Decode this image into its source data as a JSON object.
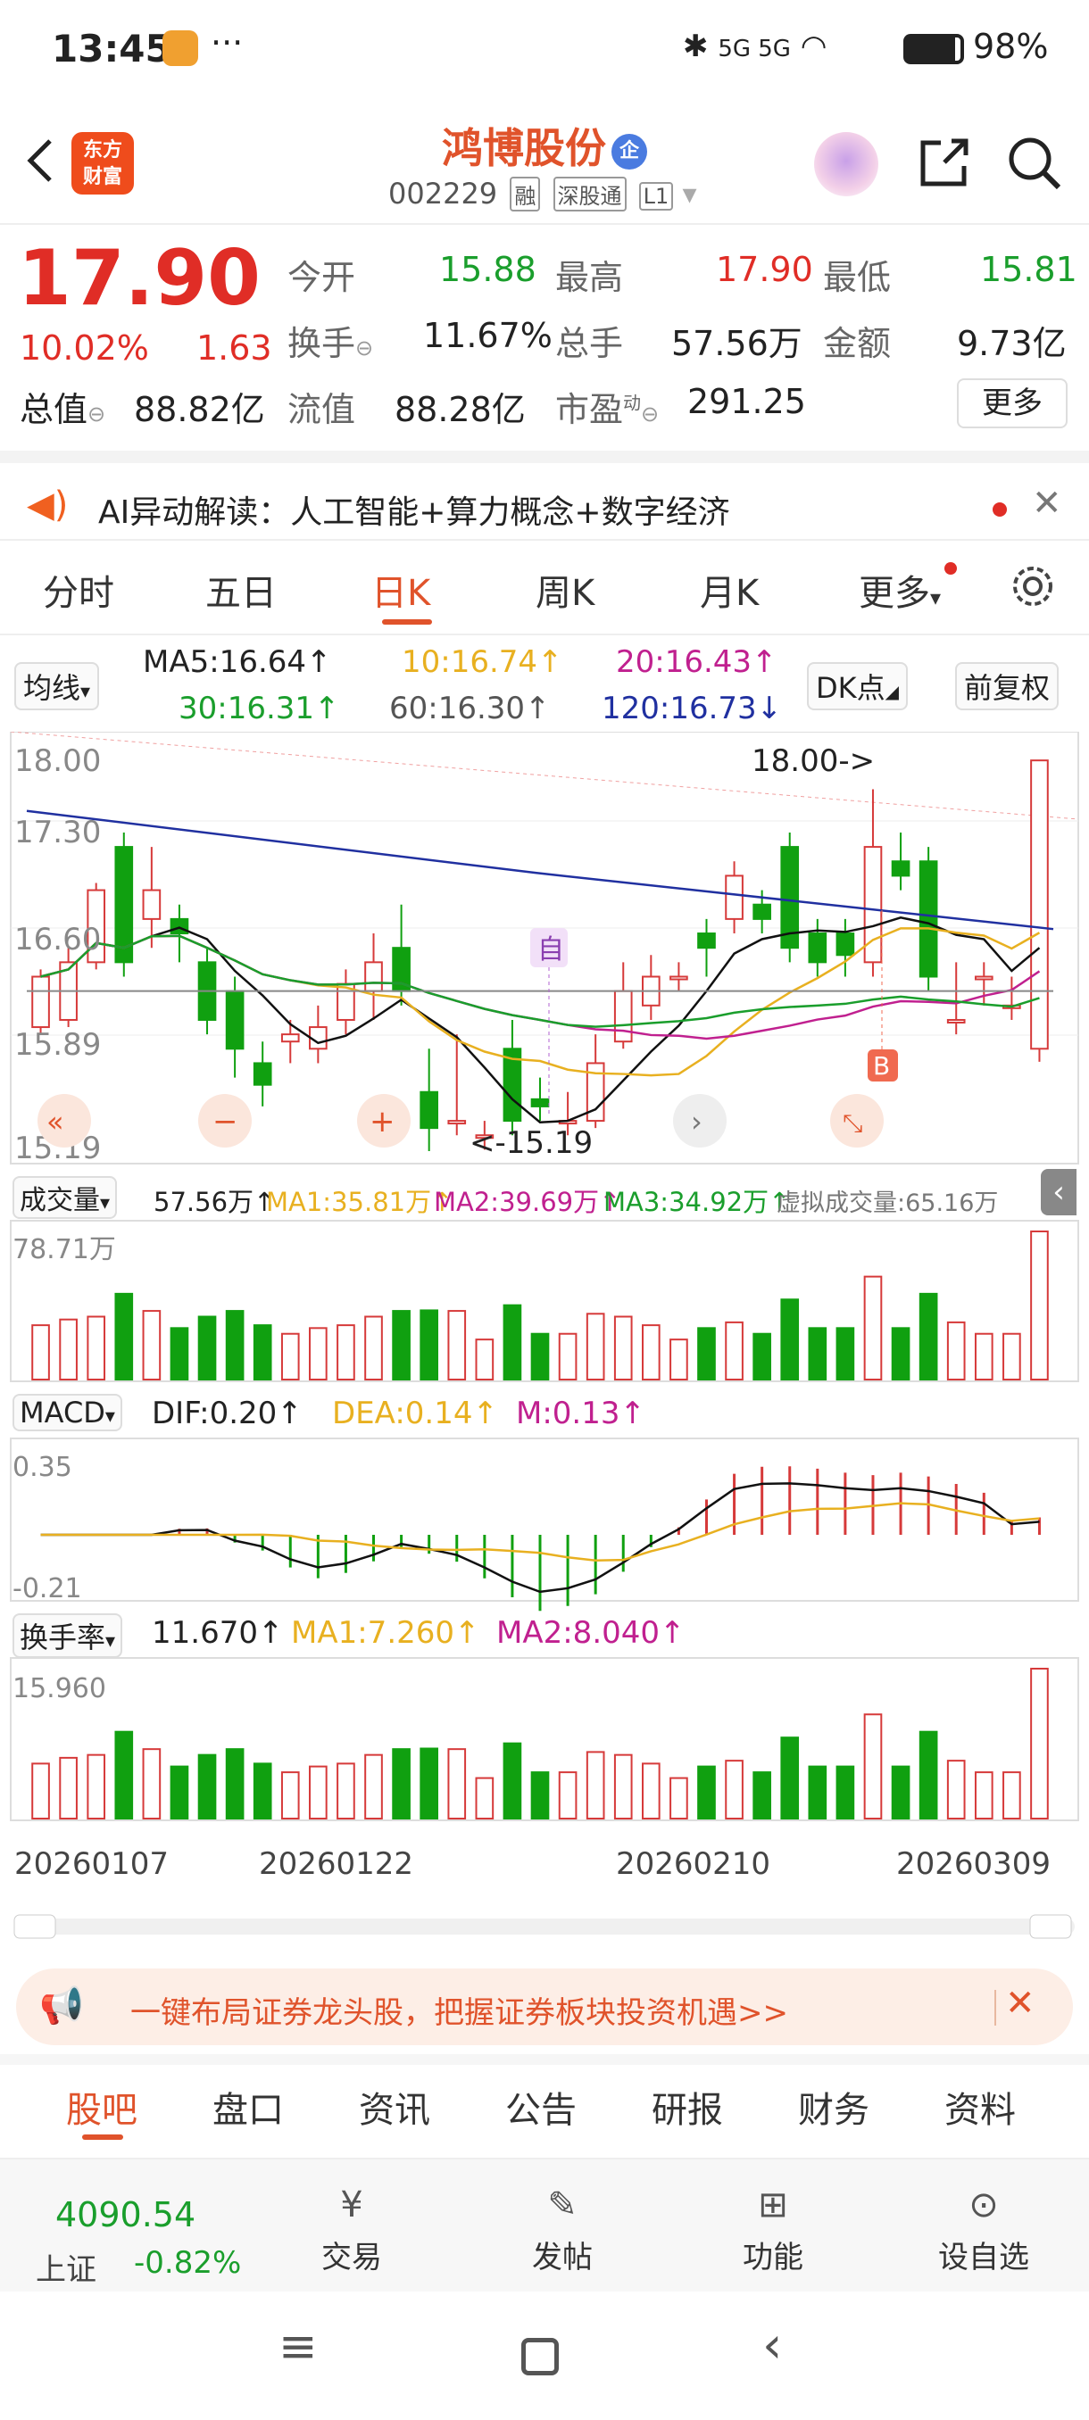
{
  "status": {
    "time": "13:45",
    "battery": "98%",
    "signal": "5G 5G"
  },
  "header": {
    "logo_text_1": "东方",
    "logo_text_2": "财富",
    "name": "鸿博股份",
    "badge": "企",
    "code": "002229",
    "tags": [
      "融",
      "深股通",
      "L1"
    ]
  },
  "quote": {
    "price": "17.90",
    "pct": "10.02%",
    "chg": "1.63",
    "open_label": "今开",
    "open": "15.88",
    "high_label": "最高",
    "high": "17.90",
    "low_label": "最低",
    "low": "15.81",
    "turnover_label": "换手",
    "turnover": "11.67%",
    "vol_label": "总手",
    "vol": "57.56万",
    "amt_label": "金额",
    "amt": "9.73亿",
    "mcap_label": "总值",
    "mcap": "88.82亿",
    "float_label": "流值",
    "float": "88.28亿",
    "pe_label": "市盈",
    "pe": "291.25",
    "pe_sup": "动",
    "more": "更多"
  },
  "ai": {
    "text": "AI异动解读：人工智能+算力概念+数字经济"
  },
  "ktabs": [
    "分时",
    "五日",
    "日K",
    "周K",
    "月K",
    "更多"
  ],
  "ma": {
    "sel": "均线",
    "ma5": "MA5:16.64↑",
    "ma10": "10:16.74↑",
    "ma20": "20:16.43↑",
    "ma30": "30:16.31↑",
    "ma60": "60:16.30↑",
    "ma120": "120:16.73↓",
    "dk": "DK点",
    "fq": "前复权"
  },
  "kline": {
    "y_labels": [
      "18.00",
      "17.30",
      "16.60",
      "15.89",
      "15.19"
    ],
    "max_label": "18.00->",
    "min_label": "<-15.19",
    "mark_zi": "自",
    "mark_b": "B"
  },
  "volume": {
    "sel": "成交量",
    "val": "57.56万↑",
    "ma1": "MA1:35.81万↑",
    "ma2": "MA2:39.69万↑",
    "ma3": "MA3:34.92万↑",
    "virtual": "虚拟成交量:65.16万",
    "ymax": "78.71万"
  },
  "macd": {
    "sel": "MACD",
    "dif": "DIF:0.20↑",
    "dea": "DEA:0.14↑",
    "m": "M:0.13↑",
    "ymax": "0.35",
    "ymin": "-0.21"
  },
  "hs": {
    "sel": "换手率",
    "val": "11.670↑",
    "ma1": "MA1:7.260↑",
    "ma2": "MA2:8.040↑",
    "ymax": "15.960"
  },
  "dates": [
    "20260107",
    "20260122",
    "20260210",
    "20260309"
  ],
  "banner": {
    "text": "一键布局证券龙头股，把握证券板块投资机遇>>"
  },
  "btabs": [
    "股吧",
    "盘口",
    "资讯",
    "公告",
    "研报",
    "财务",
    "资料"
  ],
  "bottom": {
    "index_val": "4090.54",
    "index_name": "上证",
    "index_pct": "-0.82%",
    "nav": [
      "交易",
      "发帖",
      "功能",
      "设自选"
    ]
  },
  "chart_data": {
    "type": "candlestick",
    "note_scale": "price",
    "ylim": [
      15.19,
      18.0
    ],
    "candles": [
      [
        16.05,
        16.4,
        16.0,
        16.45
      ],
      [
        16.1,
        16.5,
        16.05,
        16.6
      ],
      [
        16.5,
        17.0,
        16.45,
        17.05
      ],
      [
        17.3,
        16.5,
        16.4,
        17.4
      ],
      [
        16.8,
        17.0,
        16.6,
        17.3
      ],
      [
        16.8,
        16.7,
        16.5,
        16.9
      ],
      [
        16.5,
        16.1,
        16.0,
        16.6
      ],
      [
        16.3,
        15.9,
        15.7,
        16.4
      ],
      [
        15.8,
        15.65,
        15.5,
        15.95
      ],
      [
        15.95,
        16.0,
        15.8,
        16.1
      ],
      [
        15.9,
        16.05,
        15.8,
        16.2
      ],
      [
        16.1,
        16.35,
        16.0,
        16.45
      ],
      [
        16.3,
        16.5,
        16.1,
        16.7
      ],
      [
        16.6,
        16.3,
        16.2,
        16.9
      ],
      [
        15.6,
        15.35,
        15.19,
        15.9
      ],
      [
        15.4,
        15.4,
        15.3,
        16.0
      ],
      [
        15.3,
        15.3,
        15.2,
        15.4
      ],
      [
        15.9,
        15.4,
        15.3,
        16.1
      ],
      [
        15.55,
        15.5,
        15.4,
        15.7
      ],
      [
        15.4,
        15.4,
        15.3,
        15.6
      ],
      [
        15.4,
        15.8,
        15.35,
        16.0
      ],
      [
        15.95,
        16.3,
        15.9,
        16.5
      ],
      [
        16.2,
        16.4,
        16.1,
        16.55
      ],
      [
        16.4,
        16.4,
        16.3,
        16.5
      ],
      [
        16.7,
        16.6,
        16.4,
        16.8
      ],
      [
        16.8,
        17.1,
        16.7,
        17.2
      ],
      [
        16.9,
        16.8,
        16.7,
        17.0
      ],
      [
        17.3,
        16.6,
        16.5,
        17.4
      ],
      [
        16.7,
        16.5,
        16.4,
        16.8
      ],
      [
        16.7,
        16.55,
        16.4,
        16.8
      ],
      [
        16.5,
        17.3,
        16.4,
        17.7
      ],
      [
        17.2,
        17.1,
        17.0,
        17.4
      ],
      [
        17.2,
        16.4,
        16.3,
        17.3
      ],
      [
        16.1,
        16.1,
        16.0,
        16.5
      ],
      [
        16.4,
        16.4,
        16.2,
        16.5
      ],
      [
        16.2,
        16.2,
        16.1,
        16.4
      ],
      [
        15.9,
        17.9,
        15.81,
        17.9
      ]
    ],
    "volume_ylim": [
      0,
      78.71
    ],
    "turnover_ylim": [
      0,
      15.96
    ],
    "macd_ylim": [
      -0.21,
      0.35
    ]
  }
}
